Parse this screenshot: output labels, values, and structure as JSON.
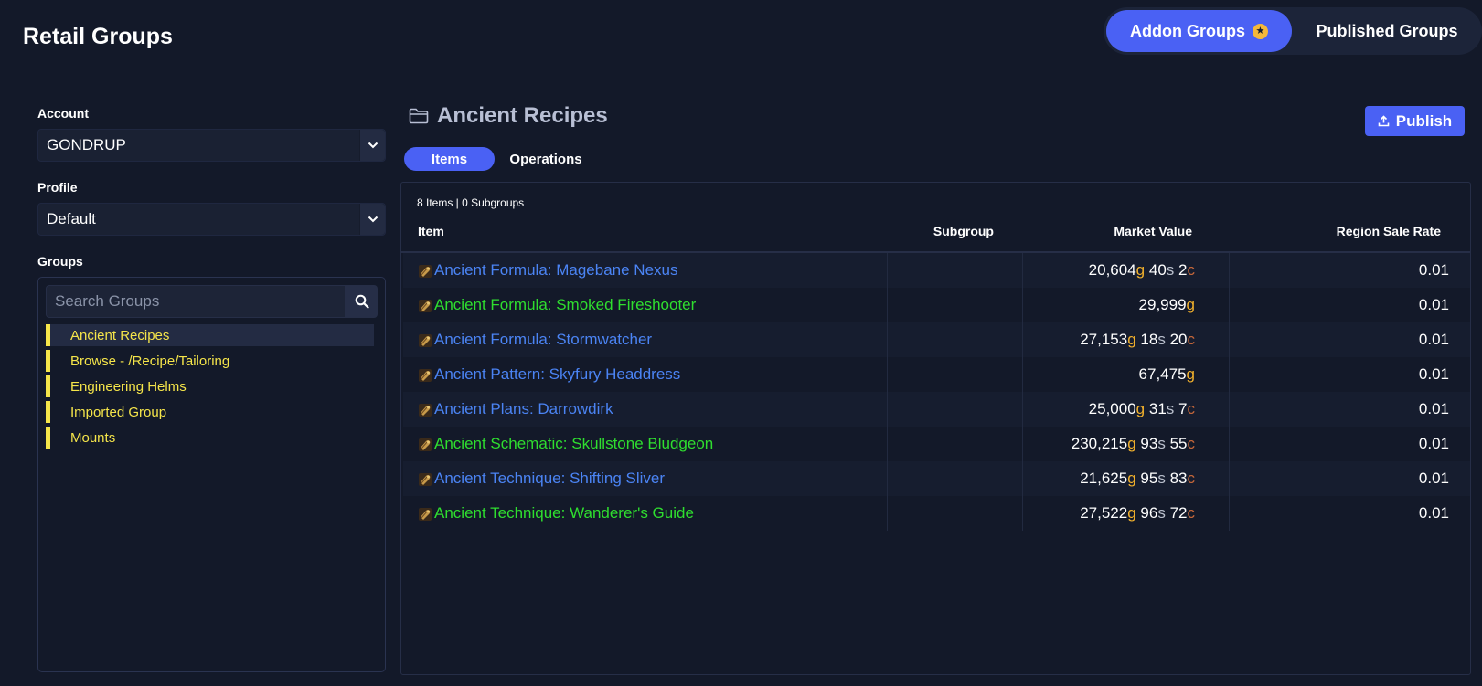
{
  "header": {
    "title": "Retail Groups",
    "toggle": {
      "addon_label": "Addon Groups",
      "published_label": "Published Groups",
      "active": "Addon Groups"
    }
  },
  "sidebar": {
    "account_label": "Account",
    "account_value": "GONDRUP",
    "profile_label": "Profile",
    "profile_value": "Default",
    "groups_label": "Groups",
    "search_placeholder": "Search Groups",
    "groups": [
      {
        "label": "Ancient Recipes",
        "selected": true
      },
      {
        "label": "Browse - /Recipe/Tailoring",
        "selected": false
      },
      {
        "label": "Engineering Helms",
        "selected": false
      },
      {
        "label": "Imported Group",
        "selected": false
      },
      {
        "label": "Mounts",
        "selected": false
      }
    ]
  },
  "main": {
    "group_title": "Ancient Recipes",
    "publish_label": "Publish",
    "tabs": [
      {
        "label": "Items",
        "active": true
      },
      {
        "label": "Operations",
        "active": false
      }
    ],
    "summary": "8 Items | 0 Subgroups",
    "columns": {
      "item": "Item",
      "subgroup": "Subgroup",
      "market_value": "Market Value",
      "region_sale_rate": "Region Sale Rate"
    },
    "rows": [
      {
        "name": "Ancient Formula: Magebane Nexus",
        "quality": "blue",
        "gold": "20,604",
        "silver": "40",
        "copper": "2",
        "rate": "0.01"
      },
      {
        "name": "Ancient Formula: Smoked Fireshooter",
        "quality": "green",
        "gold": "29,999",
        "silver": "",
        "copper": "",
        "rate": "0.01"
      },
      {
        "name": "Ancient Formula: Stormwatcher",
        "quality": "blue",
        "gold": "27,153",
        "silver": "18",
        "copper": "20",
        "rate": "0.01"
      },
      {
        "name": "Ancient Pattern: Skyfury Headdress",
        "quality": "blue",
        "gold": "67,475",
        "silver": "",
        "copper": "",
        "rate": "0.01"
      },
      {
        "name": "Ancient Plans: Darrowdirk",
        "quality": "blue",
        "gold": "25,000",
        "silver": "31",
        "copper": "7",
        "rate": "0.01"
      },
      {
        "name": "Ancient Schematic: Skullstone Bludgeon",
        "quality": "green",
        "gold": "230,215",
        "silver": "93",
        "copper": "55",
        "rate": "0.01"
      },
      {
        "name": "Ancient Technique: Shifting Sliver",
        "quality": "blue",
        "gold": "21,625",
        "silver": "95",
        "copper": "83",
        "rate": "0.01"
      },
      {
        "name": "Ancient Technique: Wanderer's Guide",
        "quality": "green",
        "gold": "27,522",
        "silver": "96",
        "copper": "72",
        "rate": "0.01"
      }
    ],
    "currency_suffix": {
      "gold": "g",
      "silver": "s",
      "copper": "c"
    }
  },
  "colors": {
    "accent": "#4a61f4",
    "group_yellow": "#f5e54a",
    "item_blue": "#4b84f4",
    "item_green": "#2fde2f",
    "gold": "#f2b12c",
    "copper": "#c8683a"
  },
  "icons": [
    "star-icon",
    "chevron-down-icon",
    "search-icon",
    "folder-icon",
    "upload-icon",
    "recipe-scroll-icon"
  ]
}
